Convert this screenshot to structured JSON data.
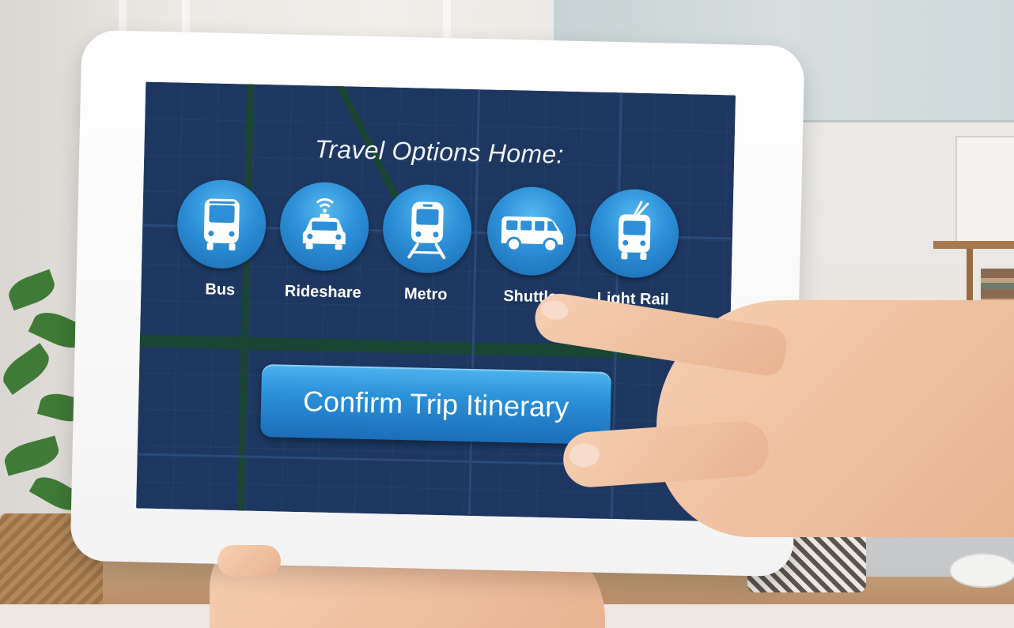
{
  "screen": {
    "title": "Travel Options Home:",
    "options": [
      {
        "label": "Bus",
        "icon": "bus-icon"
      },
      {
        "label": "Rideshare",
        "icon": "rideshare-car-icon"
      },
      {
        "label": "Metro",
        "icon": "metro-train-icon"
      },
      {
        "label": "Shuttle",
        "icon": "shuttle-van-icon"
      },
      {
        "label": "Light Rail",
        "icon": "light-rail-trolley-icon"
      }
    ],
    "confirm_label": "Confirm Trip Itinerary"
  },
  "colors": {
    "screen_background": "#1d3760",
    "button_blue": "#2a90d8",
    "text": "#ffffff"
  }
}
